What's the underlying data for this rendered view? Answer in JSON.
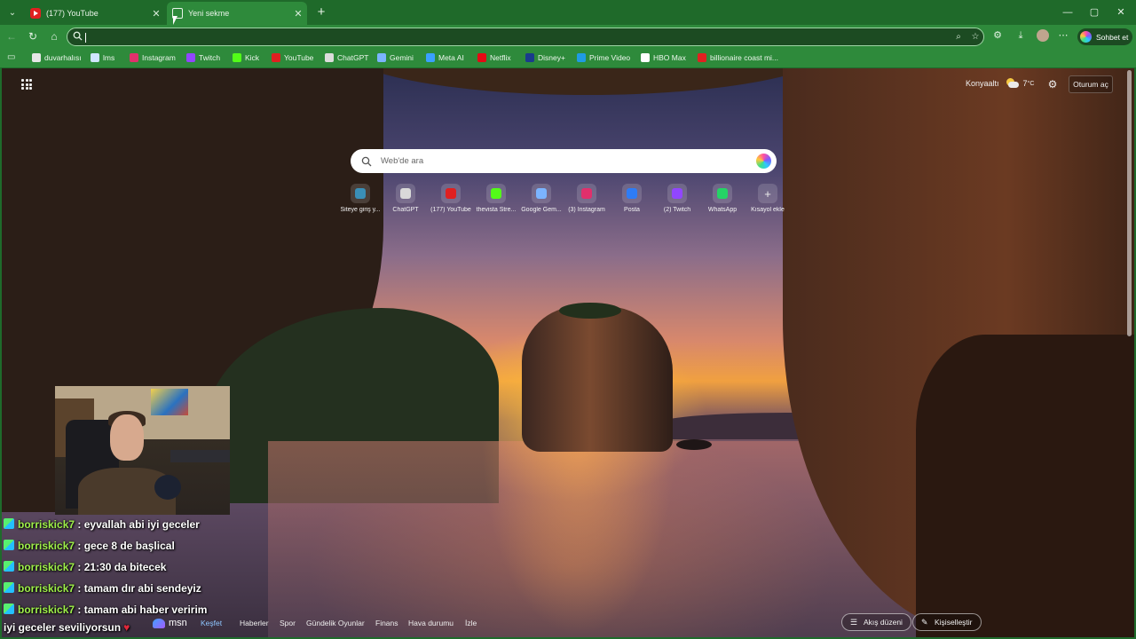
{
  "tabs": [
    {
      "title": "(177) YouTube",
      "close": "✕"
    },
    {
      "title": "Yeni sekme",
      "close": "✕"
    }
  ],
  "new_tab_symbol": "+",
  "window_controls": {
    "minimize": "—",
    "maximize": "▢",
    "close": "✕"
  },
  "nav": {
    "back": "←",
    "reload": "↻",
    "home": "⌂"
  },
  "address_bar": {
    "value": "",
    "placeholder": ""
  },
  "toolbar_icons": [
    "zoom-icon",
    "favorites-star-icon",
    "extensions-icon",
    "downloads-icon",
    "profile-avatar",
    "more-menu-icon"
  ],
  "toolbar_glyphs": {
    "zoom": "⌕",
    "star": "☆",
    "extensions": "⚙",
    "downloads": "⤓",
    "more": "⋯",
    "menu_down": "⌄",
    "collections": "▭"
  },
  "chat_button": {
    "label": "Sohbet et"
  },
  "bookmarks": [
    {
      "label": "duvarhalısı",
      "color": "#e6e6e6"
    },
    {
      "label": "lms",
      "color": "#cfe6ff"
    },
    {
      "label": "Instagram",
      "color": "#e1306c"
    },
    {
      "label": "Twitch",
      "color": "#9146ff"
    },
    {
      "label": "Kick",
      "color": "#53fc18"
    },
    {
      "label": "YouTube",
      "color": "#e02020"
    },
    {
      "label": "ChatGPT",
      "color": "#dcdcdc"
    },
    {
      "label": "Gemini",
      "color": "#7bb4ff"
    },
    {
      "label": "Meta AI",
      "color": "#3aa0ff"
    },
    {
      "label": "Netflix",
      "color": "#e50914"
    },
    {
      "label": "Disney+",
      "color": "#1a3b8c"
    },
    {
      "label": "Prime Video",
      "color": "#1f9be3"
    },
    {
      "label": "HBO Max",
      "color": "#ffffff"
    },
    {
      "label": "billionaire coast mi...",
      "color": "#e02020"
    }
  ],
  "weather": {
    "location": "Konyaaltı",
    "temp": "7",
    "unit": "°C"
  },
  "settings_glyph": "⚙",
  "signin": {
    "label": "Oturum aç"
  },
  "search": {
    "placeholder": "Web'de ara"
  },
  "quick_links": [
    {
      "label": "Siteye giriş y...",
      "color": "#3a8fb7"
    },
    {
      "label": "ChatGPT",
      "color": "#d9d9d9"
    },
    {
      "label": "(177) YouTube",
      "color": "#e02020"
    },
    {
      "label": "thevista Stre...",
      "color": "#53fc18"
    },
    {
      "label": "Google Gem...",
      "color": "#7bb4ff"
    },
    {
      "label": "(3) Instagram",
      "color": "#e1306c"
    },
    {
      "label": "Posta",
      "color": "#2e7cf6"
    },
    {
      "label": "(2) Twitch",
      "color": "#9146ff"
    },
    {
      "label": "WhatsApp",
      "color": "#25d366"
    },
    {
      "label": "Kısayol ekle",
      "color": "transparent",
      "glyph": "+"
    }
  ],
  "msn": {
    "logo": "msn"
  },
  "feed_tabs": [
    "Keşfet",
    "Haberler",
    "Spor",
    "Gündelik Oyunlar",
    "Finans",
    "Hava durumu",
    "İzle"
  ],
  "feed_buttons": {
    "layout": "Akış düzeni",
    "personalize": "Kişiselleştir",
    "layout_glyph": "☰",
    "personalize_glyph": "✎"
  },
  "chat_messages": [
    {
      "user": "borriskick7",
      "text": ": eyvallah abi iyi geceler"
    },
    {
      "user": "borriskick7",
      "text": ": gece 8 de başlical"
    },
    {
      "user": "borriskick7",
      "text": ": 21:30 da bitecek"
    },
    {
      "user": "borriskick7",
      "text": ": tamam dır abi sendeyiz"
    },
    {
      "user": "borriskick7",
      "text": ": tamam abi haber veririm"
    }
  ],
  "chat_continuation": "iyi geceler seviliyorsun",
  "heart": "♥"
}
